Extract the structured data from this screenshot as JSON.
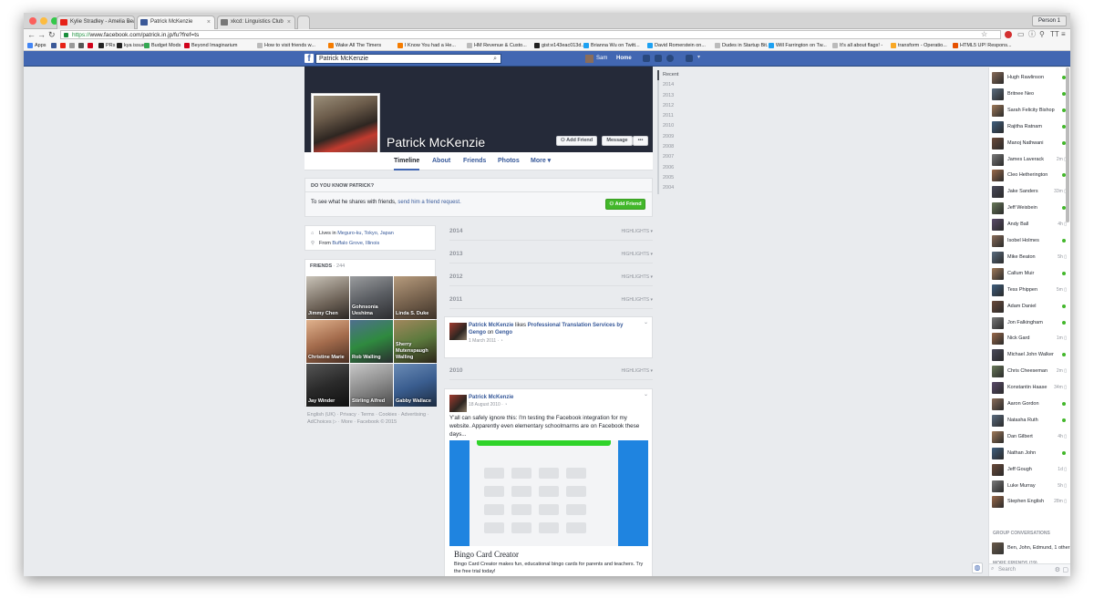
{
  "browser": {
    "tabs": [
      {
        "title": "Kylie Stradley - Amelia Bea",
        "color": "#e62117"
      },
      {
        "title": "Patrick McKenzie",
        "color": "#3b5998"
      },
      {
        "title": "xkcd: Linguistics Club",
        "color": "#777777"
      }
    ],
    "person_label": "Person 1",
    "url_scheme": "https://",
    "url_rest": "www.facebook.com/patrick.in.jp/fu?fref=ts",
    "bookmarks": [
      {
        "label": "Apps",
        "color": "#4285f4"
      },
      {
        "label": "",
        "color": "#3b5998"
      },
      {
        "label": "",
        "color": "#e62117"
      },
      {
        "label": "",
        "color": "#999999"
      },
      {
        "label": "",
        "color": "#555555"
      },
      {
        "label": "",
        "color": "#d0021b"
      },
      {
        "label": "PRs",
        "color": "#222222"
      },
      {
        "label": "kya issues",
        "color": "#222222"
      },
      {
        "label": "Budget Mods",
        "color": "#34a853"
      },
      {
        "label": "Beyond Imaginarium",
        "color": "#d0021b"
      },
      {
        "label": "How to visit friends w...",
        "color": "#bbbbbb"
      },
      {
        "label": "Wake All The Timers",
        "color": "#f57c00"
      },
      {
        "label": "I Know You had a He...",
        "color": "#f57c00"
      },
      {
        "label": "HM Revenue & Custo...",
        "color": "#bbbbbb"
      },
      {
        "label": "gist:e143eac013d...",
        "color": "#222222"
      },
      {
        "label": "Brianna Wu on Twitt...",
        "color": "#1da1f2"
      },
      {
        "label": "David Romerstein on...",
        "color": "#1da1f2"
      },
      {
        "label": "Dudes in Startup Bit...",
        "color": "#bbbbbb"
      },
      {
        "label": "Will Farrington on Tw...",
        "color": "#1da1f2"
      },
      {
        "label": "It's all about flags! -",
        "color": "#bbbbbb"
      },
      {
        "label": "transform - Operatio...",
        "color": "#f9a825"
      },
      {
        "label": "HTML5 UP! Respons...",
        "color": "#e65100"
      }
    ]
  },
  "fb": {
    "search_value": "Patrick McKenzie",
    "user": "Sam",
    "home": "Home"
  },
  "profile": {
    "name": "Patrick McKenzie",
    "add_friend": "Add Friend",
    "message": "Message",
    "more_dots": "•••",
    "tabs": [
      "Timeline",
      "About",
      "Friends",
      "Photos",
      "More ▾"
    ],
    "know_heading": "DO YOU KNOW PATRICK?",
    "know_text": "To see what he shares with friends, ",
    "know_link": "send him a friend request.",
    "add_friend_green": "Add Friend"
  },
  "intro": {
    "lives_prefix": "Lives in ",
    "lives_place": "Meguro-ku, Tokyo, Japan",
    "from_prefix": "From ",
    "from_place": "Buffalo Grove, Illinois"
  },
  "friends": {
    "heading": "FRIENDS",
    "count": "· 244",
    "list": [
      {
        "name": "Jimmy Chen",
        "bg": "linear-gradient(160deg,#c9c3b8,#6d6257 60%,#2b2622)"
      },
      {
        "name": "Gohnsonia Ueshima",
        "bg": "linear-gradient(160deg,#9a9c9e,#5b5e63 50%,#2c2d30)"
      },
      {
        "name": "Linda S. Duke",
        "bg": "linear-gradient(160deg,#b69b7d,#7a6550 50%,#3d3228)"
      },
      {
        "name": "Christine Marie",
        "bg": "linear-gradient(160deg,#e0b28d,#a36b4c 50%,#4a3024)"
      },
      {
        "name": "Rob Walling",
        "bg": "linear-gradient(160deg,#4f6f8f,#2f8a3f 50%,#2a2d30)"
      },
      {
        "name": "Sherry Mutenspaugh Walling",
        "bg": "linear-gradient(160deg,#a2875d,#5b7a3d 50%,#2c2418)"
      },
      {
        "name": "Jay Winder",
        "bg": "linear-gradient(160deg,#555,#2a2a2a 50%,#101010)"
      },
      {
        "name": "Stirling Alfred",
        "bg": "linear-gradient(160deg,#c8c8c8,#8c8c8c 50%,#4a4a4a)"
      },
      {
        "name": "Gabby Wallace",
        "bg": "linear-gradient(160deg,#6a8bb5,#3a5d8f 50%,#1c2b40)"
      }
    ],
    "footer": "English (UK) · Privacy · Terms · Cookies · Advertising · AdChoices ▷ · More · Facebook © 2015"
  },
  "timeline": {
    "highlights_label": "HIGHLIGHTS ▾",
    "years_top": [
      "2014",
      "2013",
      "2012",
      "2011"
    ],
    "post1": {
      "author": "Patrick McKenzie",
      "action": " likes ",
      "page": "Professional Translation Services by Gengo",
      "on": " on ",
      "site": "Gengo",
      "date": "1 March 2011 · ◔"
    },
    "year_mid": "2010",
    "post2": {
      "author": "Patrick McKenzie",
      "date": "18 August 2010 · ◔",
      "body": "Y'all can safely ignore this: I'm testing the Facebook integration for my website. Apparently even elementary schoolmarms are on Facebook these days...",
      "link_title": "Bingo Card Creator",
      "link_desc": "Bingo Card Creator makes fun, educational bingo cards for parents and teachers. Try the free trial today!"
    }
  },
  "years_nav": [
    "Recent",
    "2014",
    "2013",
    "2012",
    "2011",
    "2010",
    "2009",
    "2008",
    "2007",
    "2006",
    "2005",
    "2004"
  ],
  "chat": {
    "contacts": [
      {
        "name": "Hugh Rawlinson",
        "status": "online",
        "time": ""
      },
      {
        "name": "Britnee Neo",
        "status": "online",
        "time": ""
      },
      {
        "name": "Sarah Felicity Bishop",
        "status": "online",
        "time": ""
      },
      {
        "name": "Rajitha Ratnam",
        "status": "online",
        "time": ""
      },
      {
        "name": "Manoj Nathwani",
        "status": "online",
        "time": ""
      },
      {
        "name": "James Laverack",
        "status": "away",
        "time": "2m ▯"
      },
      {
        "name": "Cleo Hetherington",
        "status": "online",
        "time": ""
      },
      {
        "name": "Jake Sanders",
        "status": "away",
        "time": "33m ▯"
      },
      {
        "name": "Jeff Weisbein",
        "status": "online",
        "time": ""
      },
      {
        "name": "Andy Ball",
        "status": "away",
        "time": "4h ▯"
      },
      {
        "name": "Isobel Holmes",
        "status": "online",
        "time": ""
      },
      {
        "name": "Mike Beaton",
        "status": "away",
        "time": "5h ▯"
      },
      {
        "name": "Callum Muir",
        "status": "online",
        "time": ""
      },
      {
        "name": "Tess Phippen",
        "status": "away",
        "time": "5m ▯"
      },
      {
        "name": "Adam Daniel",
        "status": "online",
        "time": ""
      },
      {
        "name": "Jon Falkingham",
        "status": "online",
        "time": ""
      },
      {
        "name": "Nick Gard",
        "status": "away",
        "time": "1m ▯"
      },
      {
        "name": "Michael John Walker",
        "status": "online",
        "time": ""
      },
      {
        "name": "Chris Cheeseman",
        "status": "away",
        "time": "2m ▯"
      },
      {
        "name": "Konstantin Haase",
        "status": "away",
        "time": "34m ▯"
      },
      {
        "name": "Aaron Gordon",
        "status": "online",
        "time": ""
      },
      {
        "name": "Natasha Ruth",
        "status": "online",
        "time": ""
      },
      {
        "name": "Dan Gilbert",
        "status": "away",
        "time": "4h ▯"
      },
      {
        "name": "Nathan John",
        "status": "online",
        "time": ""
      },
      {
        "name": "Jeff Gough",
        "status": "away",
        "time": "1d ▯"
      },
      {
        "name": "Luke Murray",
        "status": "away",
        "time": "5h ▯"
      },
      {
        "name": "Stephen English",
        "status": "away",
        "time": "28m ▯"
      }
    ],
    "group_heading": "GROUP CONVERSATIONS",
    "group_item": "Ben, John, Edmund, 1 other",
    "more_heading": "MORE FRIENDS (19)",
    "more_item": "Andrew Carroll",
    "search_placeholder": "Search"
  },
  "colors": {
    "fb_blue": "#4267b2",
    "link": "#365899",
    "green": "#42b72a"
  }
}
